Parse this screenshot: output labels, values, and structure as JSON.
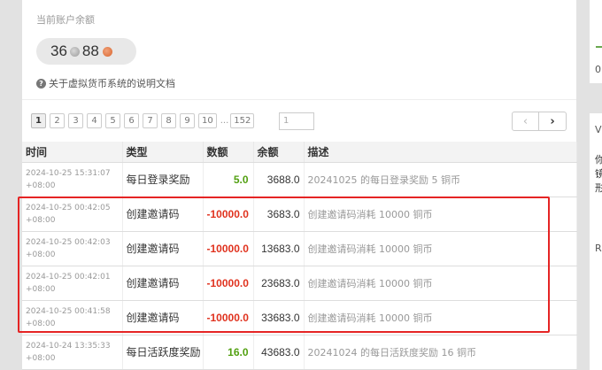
{
  "balance": {
    "label": "当前账户余额",
    "silver": "36",
    "copper": "88"
  },
  "doc_link": "关于虚拟货币系统的说明文档",
  "pager": {
    "pages": [
      "1",
      "2",
      "3",
      "4",
      "5",
      "6",
      "7",
      "8",
      "9",
      "10"
    ],
    "ellipsis": "...",
    "last": "152",
    "input_value": "1",
    "prev": "‹",
    "next": "›"
  },
  "table": {
    "headers": [
      "时间",
      "类型",
      "数额",
      "余额",
      "描述"
    ],
    "rows": [
      {
        "date": "2024-10-25 15:31:07",
        "tz": "+08:00",
        "type": "每日登录奖励",
        "amount": "5.0",
        "sign": "pos",
        "balance": "3688.0",
        "desc": "20241025 的每日登录奖励 5 铜币"
      },
      {
        "date": "2024-10-25 00:42:05",
        "tz": "+08:00",
        "type": "创建邀请码",
        "amount": "-10000.0",
        "sign": "neg",
        "balance": "3683.0",
        "desc": "创建邀请码消耗 10000 铜币"
      },
      {
        "date": "2024-10-25 00:42:03",
        "tz": "+08:00",
        "type": "创建邀请码",
        "amount": "-10000.0",
        "sign": "neg",
        "balance": "13683.0",
        "desc": "创建邀请码消耗 10000 铜币"
      },
      {
        "date": "2024-10-25 00:42:01",
        "tz": "+08:00",
        "type": "创建邀请码",
        "amount": "-10000.0",
        "sign": "neg",
        "balance": "23683.0",
        "desc": "创建邀请码消耗 10000 铜币"
      },
      {
        "date": "2024-10-25 00:41:58",
        "tz": "+08:00",
        "type": "创建邀请码",
        "amount": "-10000.0",
        "sign": "neg",
        "balance": "33683.0",
        "desc": "创建邀请码消耗 10000 铜币"
      },
      {
        "date": "2024-10-24 13:35:33",
        "tz": "+08:00",
        "type": "每日活跃度奖励",
        "amount": "16.0",
        "sign": "pos",
        "balance": "43683.0",
        "desc": "20241024 的每日活跃度奖励 16 铜币"
      }
    ]
  },
  "side": {
    "t1": "0",
    "t2": "V",
    "t3": "你",
    "t4": "镜",
    "t5": "形",
    "t6": "R"
  },
  "colors": {
    "positive": "#52a011",
    "negative": "#e0321e",
    "highlight": "#e52424"
  }
}
